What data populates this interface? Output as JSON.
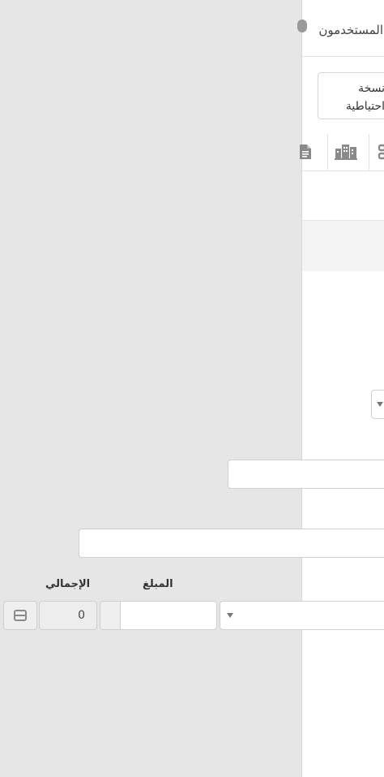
{
  "header": {
    "users_label": "المستخدمون"
  },
  "toolbar": {
    "backup_line1": "نسخة",
    "backup_line2": "احتياطية"
  },
  "icons": {
    "document": "document-icon",
    "buildings": "buildings-icon",
    "connections": "connections-icon",
    "delete_row": "delete-row-icon",
    "dropdown": "chevron-down-icon"
  },
  "form": {
    "amount_label": "المبلغ",
    "total_label": "الإجمالي",
    "total_value": "0"
  },
  "colors": {
    "overlay": "#e6e6e6",
    "panel": "#ffffff",
    "border": "#cfcfcf",
    "icon": "#8a8a8a"
  }
}
